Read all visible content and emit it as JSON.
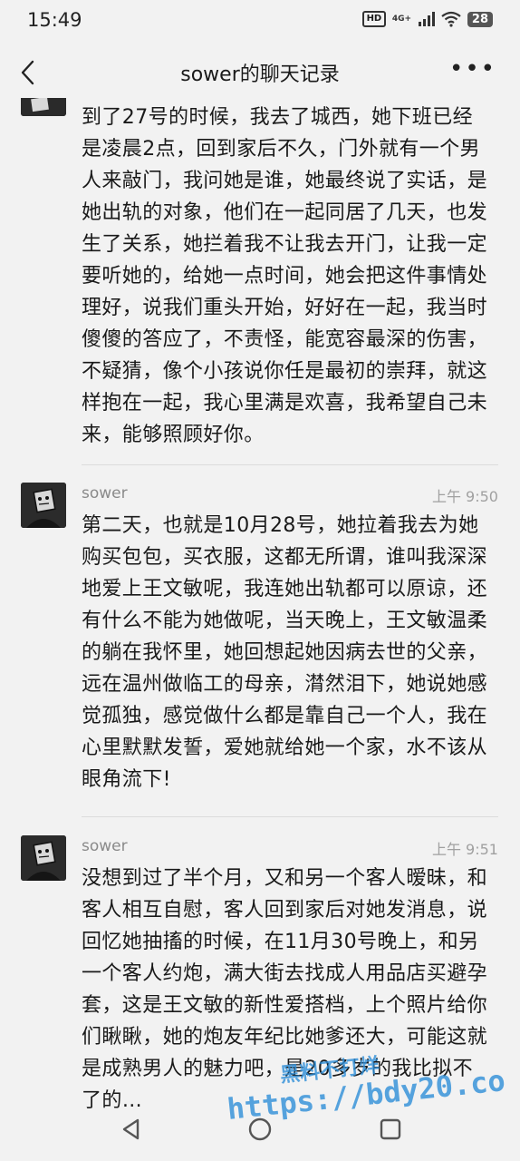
{
  "status": {
    "time": "15:49",
    "hd": "HD",
    "network": "4G+",
    "battery": "28"
  },
  "header": {
    "title": "sower的聊天记录"
  },
  "messages": [
    {
      "sender": "",
      "time": "",
      "text": "到了27号的时候，我去了城西，她下班已经是凌晨2点，回到家后不久，门外就有一个男人来敲门，我问她是谁，她最终说了实话，是她出轨的对象，他们在一起同居了几天，也发生了关系，她拦着我不让我去开门，让我一定要听她的，给她一点时间，她会把这件事情处理好，说我们重头开始，好好在一起，我当时傻傻的答应了，不责怪，能宽容最深的伤害，不疑猜，像个小孩说你任是最初的崇拜，就这样抱在一起，我心里满是欢喜，我希望自己未来，能够照顾好你。"
    },
    {
      "sender": "sower",
      "time": "上午 9:50",
      "text": "第二天，也就是10月28号，她拉着我去为她购买包包，买衣服，这都无所谓，谁叫我深深地爱上王文敏呢，我连她出轨都可以原谅，还有什么不能为她做呢，当天晚上，王文敏温柔的躺在我怀里，她回想起她因病去世的父亲，远在温州做临工的母亲，潸然泪下，她说她感觉孤独，感觉做什么都是靠自己一个人，我在心里默默发誓，爱她就给她一个家，水不该从眼角流下!"
    },
    {
      "sender": "sower",
      "time": "上午 9:51",
      "text": "没想到过了半个月，又和另一个客人暧昧，和客人相互自慰，客人回到家后对她发消息，说回忆她抽搐的时候，在11月30号晚上，和另一个客人约炮，满大街去找成人用品店买避孕套，这是王文敏的新性爱搭档，上个照片给你们瞅瞅，她的炮友年纪比她爹还大，可能这就是成熟男人的魅力吧，是20多岁的我比拟不了的…"
    }
  ],
  "watermark": {
    "cn": "黑料不打烊",
    "url": "https://bdy20.co"
  }
}
